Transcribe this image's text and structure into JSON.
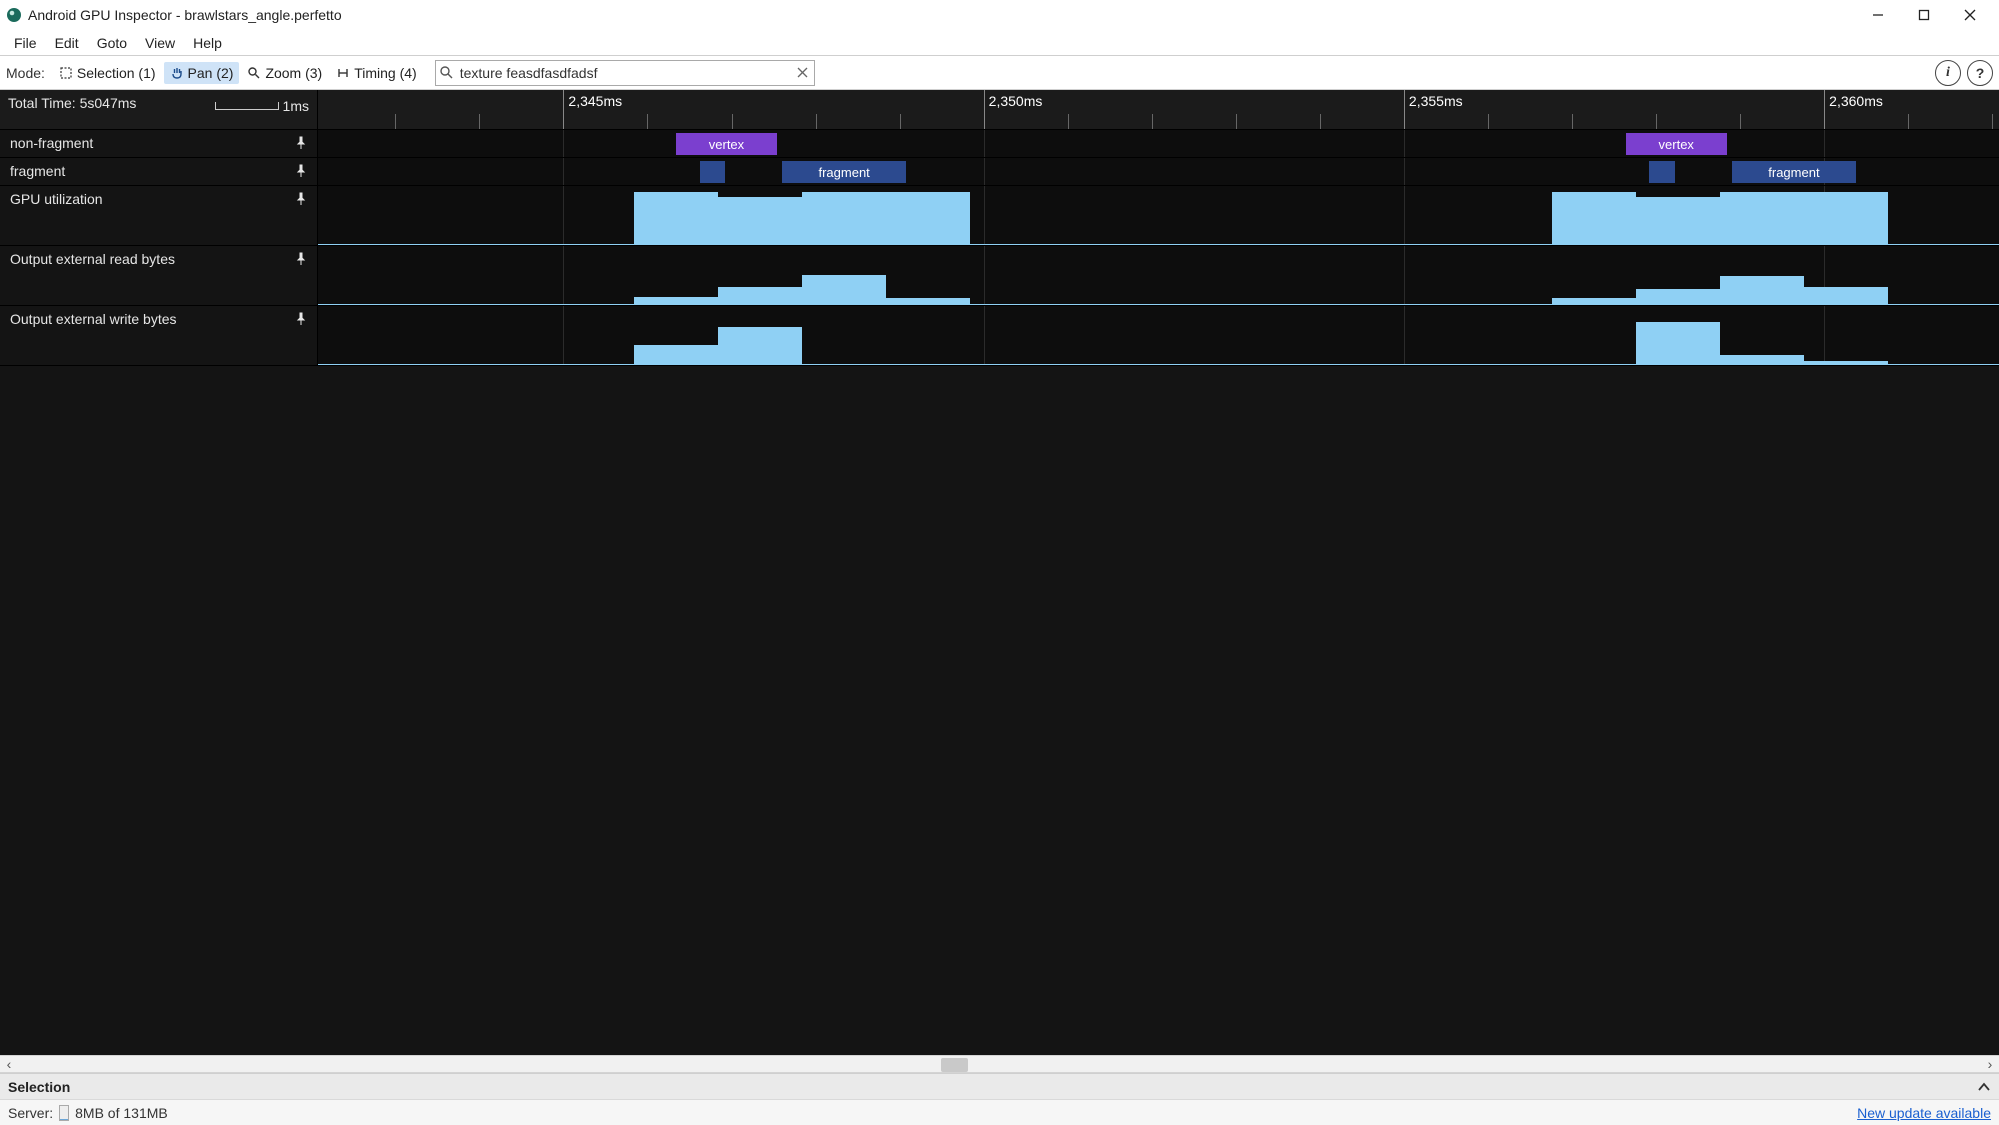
{
  "window": {
    "title": "Android GPU Inspector - brawlstars_angle.perfetto"
  },
  "menu": {
    "items": [
      "File",
      "Edit",
      "Goto",
      "View",
      "Help"
    ]
  },
  "toolbar": {
    "mode_label": "Mode:",
    "modes": [
      {
        "label": "Selection (1)",
        "active": false
      },
      {
        "label": "Pan (2)",
        "active": true
      },
      {
        "label": "Zoom (3)",
        "active": false
      },
      {
        "label": "Timing (4)",
        "active": false
      }
    ],
    "search_value": "texture feasdfasdfadsf",
    "info_glyph": "i",
    "help_glyph": "?"
  },
  "ruler": {
    "total_time_label": "Total Time: 5s047ms",
    "scale_label": "1ms",
    "majors": [
      {
        "pct": 14.6,
        "label": "2,345ms"
      },
      {
        "pct": 39.6,
        "label": "2,350ms"
      },
      {
        "pct": 64.6,
        "label": "2,355ms"
      },
      {
        "pct": 89.6,
        "label": "2,360ms"
      }
    ],
    "minors_pct": [
      4.6,
      9.6,
      19.6,
      24.6,
      29.6,
      34.6,
      44.6,
      49.6,
      54.6,
      59.6,
      69.6,
      74.6,
      79.6,
      84.6,
      94.6,
      99.6
    ]
  },
  "tracks": [
    {
      "name": "non-fragment",
      "kind": "slice",
      "height": "thin",
      "slices": [
        {
          "left_pct": 21.3,
          "width_pct": 6.0,
          "color": "purple",
          "label": "vertex"
        },
        {
          "left_pct": 77.8,
          "width_pct": 6.0,
          "color": "purple",
          "label": "vertex"
        }
      ]
    },
    {
      "name": "fragment",
      "kind": "slice",
      "height": "thin",
      "slices": [
        {
          "left_pct": 22.7,
          "width_pct": 1.5,
          "color": "navy",
          "label": ""
        },
        {
          "left_pct": 27.6,
          "width_pct": 7.4,
          "color": "navy",
          "label": "fragment"
        },
        {
          "left_pct": 79.2,
          "width_pct": 1.5,
          "color": "navy",
          "label": ""
        },
        {
          "left_pct": 84.1,
          "width_pct": 7.4,
          "color": "navy",
          "label": "fragment"
        }
      ]
    },
    {
      "name": "GPU utilization",
      "kind": "bars",
      "height": "tall",
      "bars": [
        {
          "left_pct": 18.8,
          "width_pct": 5.0,
          "height_pct": 88
        },
        {
          "left_pct": 23.8,
          "width_pct": 5.0,
          "height_pct": 80
        },
        {
          "left_pct": 28.8,
          "width_pct": 5.0,
          "height_pct": 88
        },
        {
          "left_pct": 33.8,
          "width_pct": 5.0,
          "height_pct": 88
        },
        {
          "left_pct": 73.4,
          "width_pct": 5.0,
          "height_pct": 88
        },
        {
          "left_pct": 78.4,
          "width_pct": 5.0,
          "height_pct": 80
        },
        {
          "left_pct": 83.4,
          "width_pct": 5.0,
          "height_pct": 88
        },
        {
          "left_pct": 88.4,
          "width_pct": 5.0,
          "height_pct": 88
        }
      ]
    },
    {
      "name": "Output external read bytes",
      "kind": "bars",
      "height": "tall",
      "bars": [
        {
          "left_pct": 18.8,
          "width_pct": 5.0,
          "height_pct": 12
        },
        {
          "left_pct": 23.8,
          "width_pct": 5.0,
          "height_pct": 28
        },
        {
          "left_pct": 28.8,
          "width_pct": 5.0,
          "height_pct": 50
        },
        {
          "left_pct": 33.8,
          "width_pct": 5.0,
          "height_pct": 10
        },
        {
          "left_pct": 73.4,
          "width_pct": 5.0,
          "height_pct": 10
        },
        {
          "left_pct": 78.4,
          "width_pct": 5.0,
          "height_pct": 26
        },
        {
          "left_pct": 83.4,
          "width_pct": 5.0,
          "height_pct": 48
        },
        {
          "left_pct": 88.4,
          "width_pct": 5.0,
          "height_pct": 28
        }
      ]
    },
    {
      "name": "Output external write bytes",
      "kind": "bars",
      "height": "tall",
      "bars": [
        {
          "left_pct": 18.8,
          "width_pct": 5.0,
          "height_pct": 32
        },
        {
          "left_pct": 23.8,
          "width_pct": 5.0,
          "height_pct": 62
        },
        {
          "left_pct": 78.4,
          "width_pct": 5.0,
          "height_pct": 72
        },
        {
          "left_pct": 83.4,
          "width_pct": 5.0,
          "height_pct": 16
        },
        {
          "left_pct": 88.4,
          "width_pct": 5.0,
          "height_pct": 5
        }
      ]
    }
  ],
  "selection_panel": {
    "title": "Selection"
  },
  "status": {
    "server_label": "Server:",
    "mem_text": "8MB of 131MB",
    "mem_fill_pct": 6,
    "update_text": "New update available"
  },
  "scrollbar": {
    "thumb_left_pct": 47.0,
    "thumb_width_pct": 1.4
  }
}
